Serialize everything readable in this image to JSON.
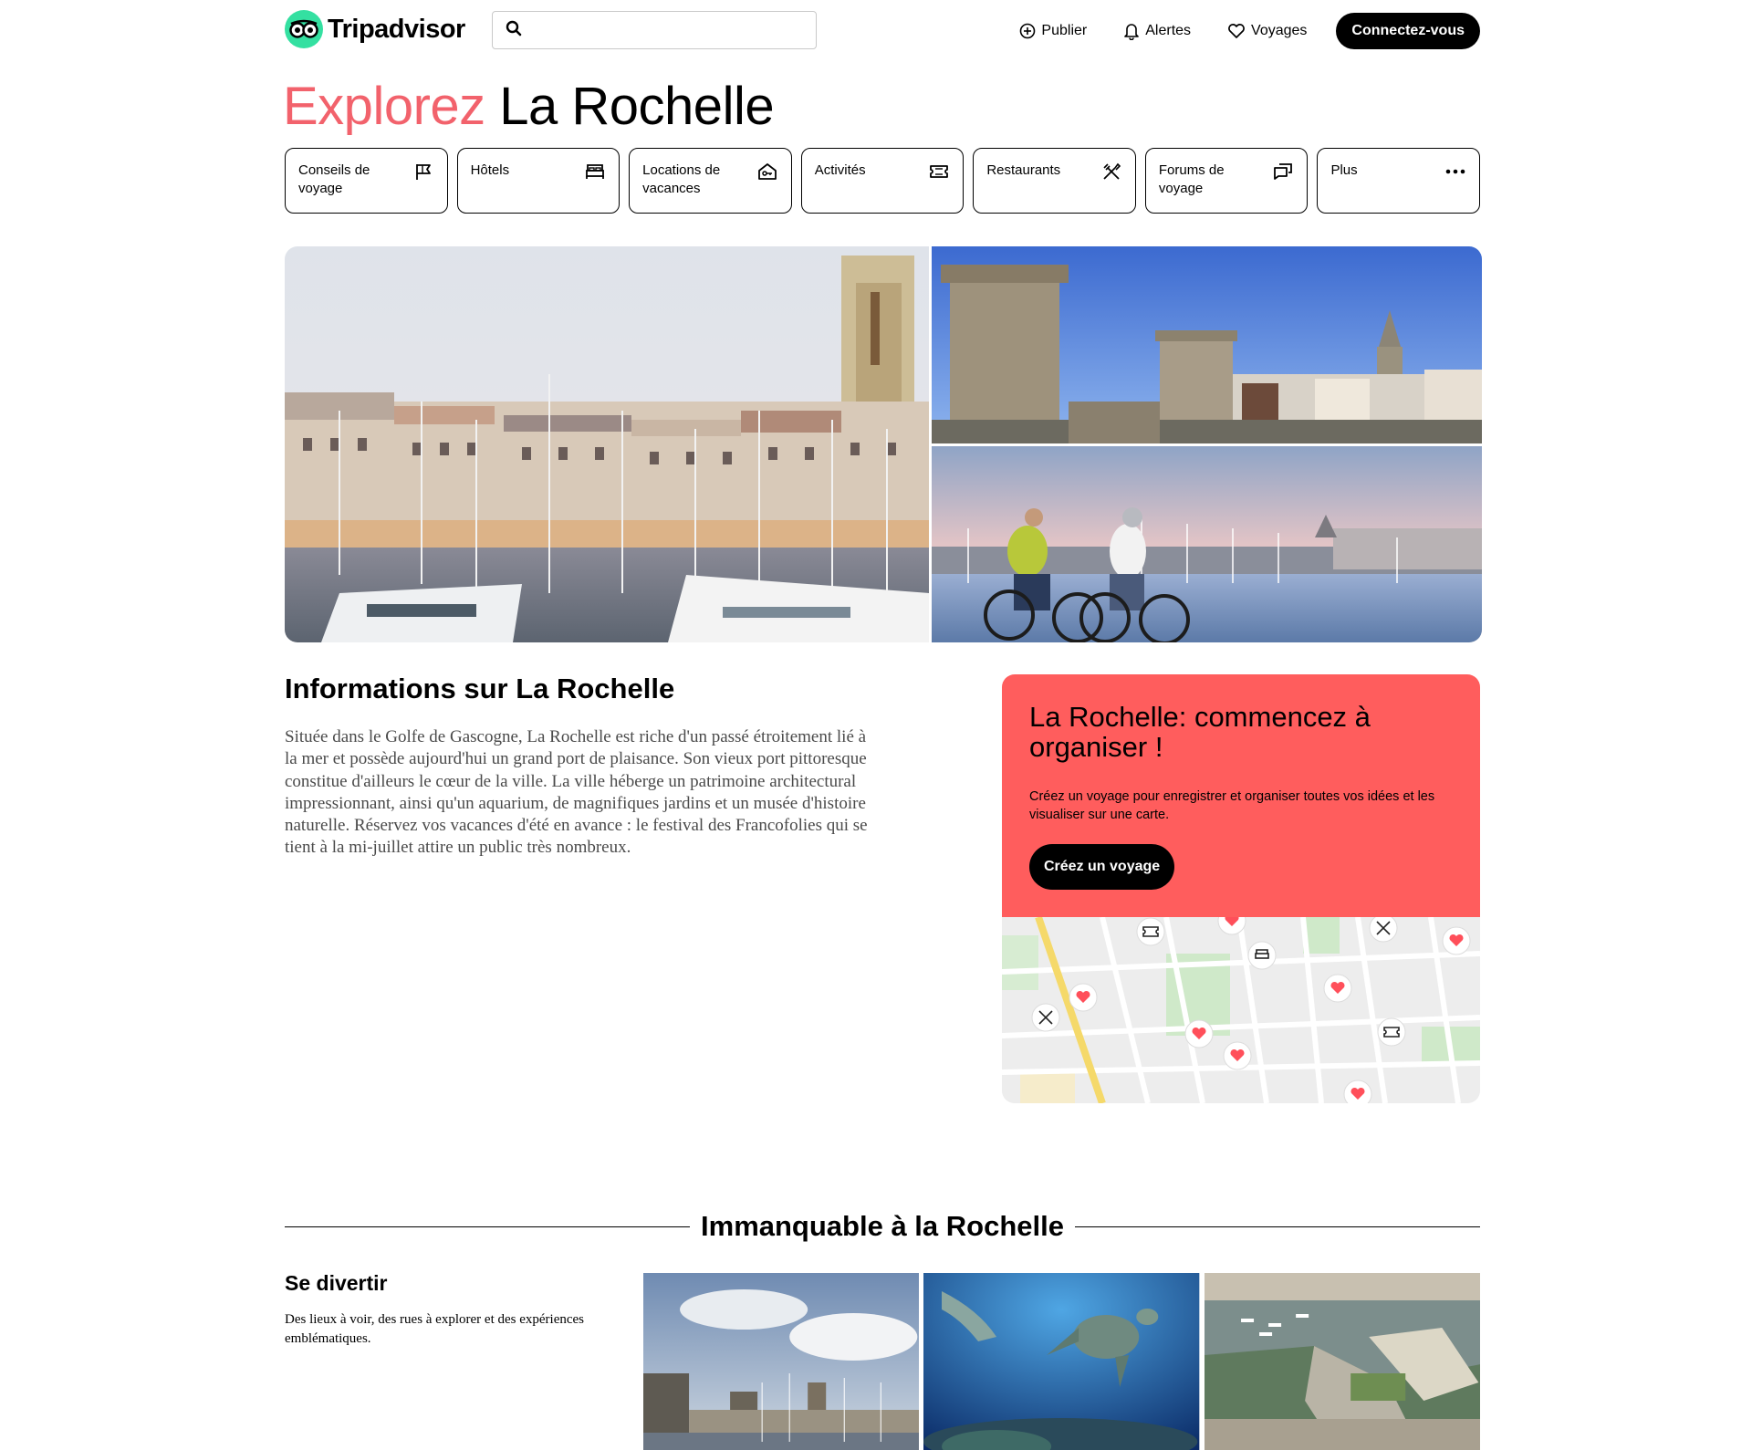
{
  "header": {
    "logo_text": "Tripadvisor",
    "search_placeholder": "",
    "nav": {
      "publish": "Publier",
      "alerts": "Alertes",
      "trips": "Voyages"
    },
    "login": "Connectez-vous"
  },
  "title": {
    "accent": "Explorez",
    "place": "La Rochelle"
  },
  "tiles": [
    {
      "label": "Conseils de voyage",
      "icon": "flag-icon"
    },
    {
      "label": "Hôtels",
      "icon": "bed-icon"
    },
    {
      "label": "Locations de vacances",
      "icon": "house-icon"
    },
    {
      "label": "Activités",
      "icon": "ticket-icon"
    },
    {
      "label": "Restaurants",
      "icon": "utensils-icon"
    },
    {
      "label": "Forums de voyage",
      "icon": "chat-icon"
    },
    {
      "label": "Plus",
      "icon": "more-icon"
    }
  ],
  "info": {
    "title": "Informations sur La Rochelle",
    "text": "Située dans le Golfe de Gascogne, La Rochelle est riche d'un passé étroitement lié à la mer et possède aujourd'hui un grand port de plaisance. Son vieux port pittoresque constitue d'ailleurs le cœur de la ville. La ville héberge un patrimoine architectural impressionnant, ainsi qu'un aquarium, de magnifiques jardins et un musée d'histoire naturelle. Réservez vos vacances d'été en avance : le festival des Francofolies qui se tient à la mi-juillet attire un public très nombreux."
  },
  "trip_card": {
    "title": "La Rochelle: commencez à organiser !",
    "description": "Créez un voyage pour enregistrer et organiser toutes vos idées et les visualiser sur une carte.",
    "button": "Créez un voyage"
  },
  "must_see": {
    "title": "Immanquable à la Rochelle",
    "fun_title": "Se divertir",
    "fun_desc": "Des lieux à voir, des rues à explorer et des expériences emblématiques."
  },
  "colors": {
    "accent_title": "#f2626c",
    "card_bg": "#ff5d5d",
    "logo_green": "#34e0a1"
  }
}
